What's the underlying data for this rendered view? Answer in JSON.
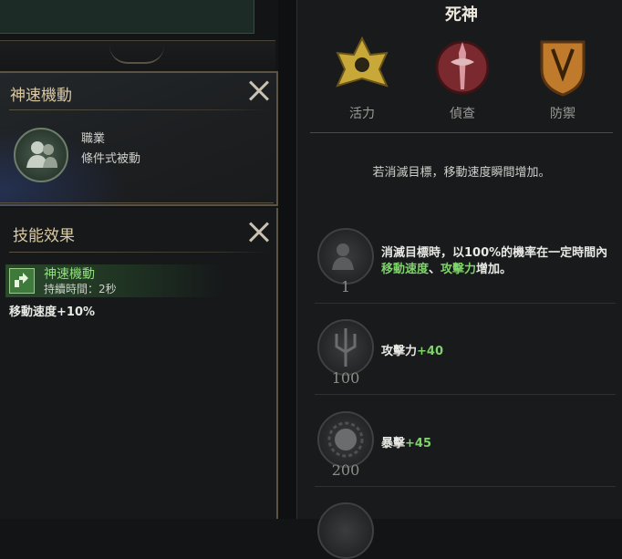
{
  "skill_panel": {
    "title": "神速機動",
    "category": "職業",
    "type": "條件式被動"
  },
  "effect_panel": {
    "title": "技能效果",
    "buff_name": "神速機動",
    "buff_duration": "持續時間：2秒",
    "effect": "移動速度+10%"
  },
  "class_panel": {
    "title": "死神",
    "emblems": [
      {
        "label": "活力",
        "icon": "vitality-emblem-icon",
        "color": "#c9a83a"
      },
      {
        "label": "偵查",
        "icon": "scout-emblem-icon",
        "color": "#a8363c"
      },
      {
        "label": "防禦",
        "icon": "defense-emblem-icon",
        "color": "#c07a2c"
      }
    ],
    "description": "若消滅目標，移動速度瞬間增加。",
    "perks": [
      {
        "level": "1",
        "line1": "消滅目標時，以100%的機率在一定時間內",
        "kw1": "移動速度",
        "sep": "、",
        "kw2": "攻擊力",
        "suffix": "增加。"
      },
      {
        "level": "100",
        "stat": "攻擊力",
        "bonus": "+40"
      },
      {
        "level": "200",
        "stat": "暴擊",
        "bonus": "+45"
      }
    ]
  }
}
